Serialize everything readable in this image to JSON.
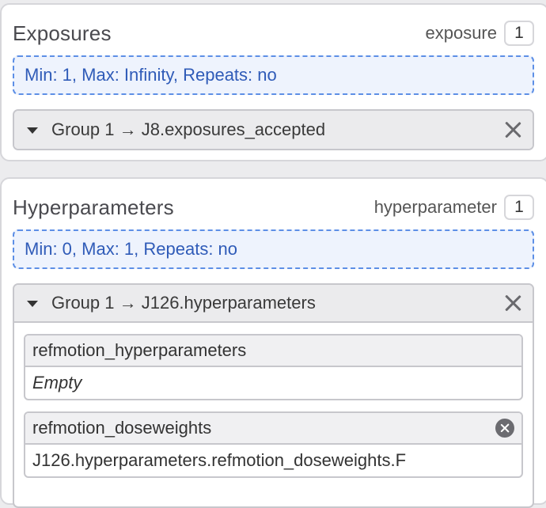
{
  "exposures": {
    "title": "Exposures",
    "type_label": "exposure",
    "count": "1",
    "constraint": "Min: 1, Max: Infinity, Repeats: no",
    "group": {
      "title": "Group 1 → J8.exposures_accepted",
      "collapsed": false
    }
  },
  "hyperparameters": {
    "title": "Hyperparameters",
    "type_label": "hyperparameter",
    "count": "1",
    "constraint": "Min: 0, Max: 1, Repeats: no",
    "group": {
      "title": "Group 1 → J126.hyperparameters",
      "slots": [
        {
          "name": "refmotion_hyperparameters",
          "value": "Empty",
          "empty": true
        },
        {
          "name": "refmotion_doseweights",
          "value": "J126.hyperparameters.refmotion_doseweights.F",
          "empty": false
        }
      ]
    }
  },
  "colors": {
    "constraint_text": "#2f5bb8",
    "constraint_border": "#5d8fe6",
    "constraint_bg": "#eef3fd"
  },
  "icons": {
    "caret": "caret-down-icon",
    "remove": "close-icon",
    "clear": "clear-circle-icon"
  }
}
